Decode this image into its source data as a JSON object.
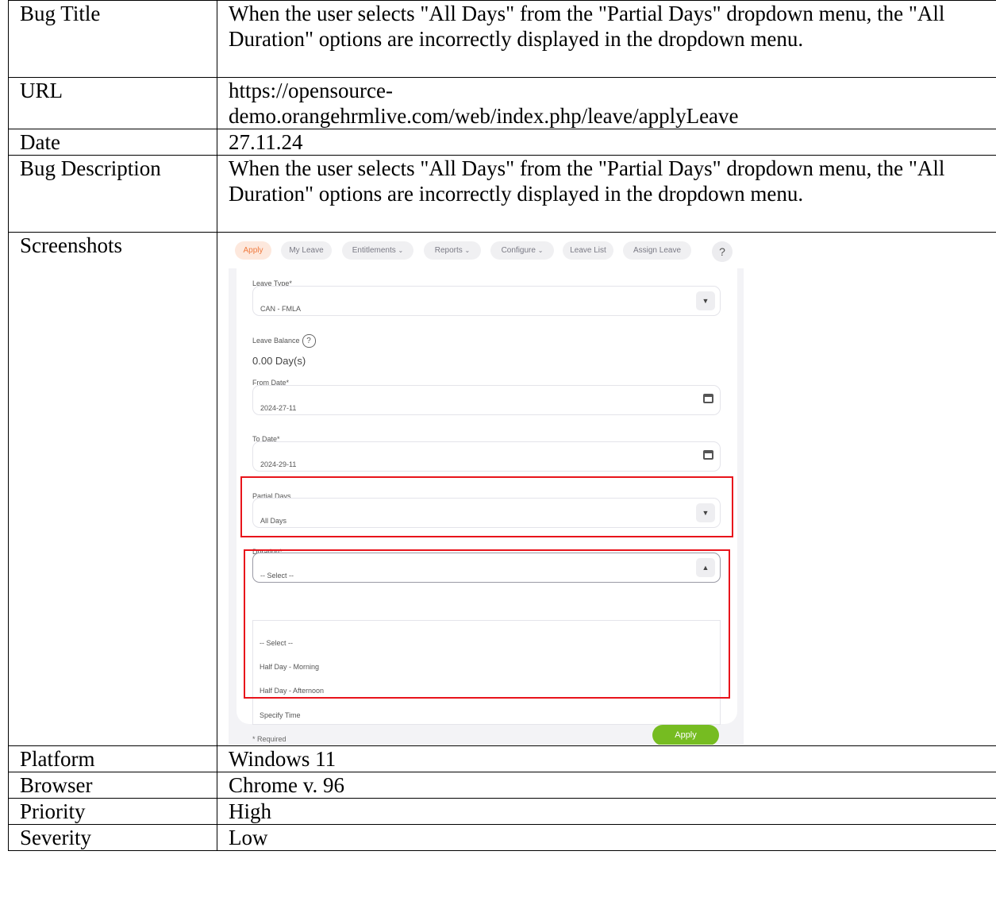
{
  "rows": {
    "bug_title": {
      "label": "Bug Title",
      "value": "When the user selects \"All Days\" from the \"Partial Days\" dropdown menu, the \"All Duration\" options are incorrectly displayed in the dropdown menu."
    },
    "url": {
      "label": "URL",
      "value": "https://opensource-demo.orangehrmlive.com/web/index.php/leave/applyLeave",
      "value_line1": "https://opensource-",
      "value_line2": "demo.orangehrmlive.com/web/index.php/leave/applyLeave"
    },
    "date": {
      "label": "Date",
      "value": "27.11.24"
    },
    "bug_description": {
      "label": "Bug Description",
      "value": "When the user selects \"All Days\" from the \"Partial Days\" dropdown menu, the \"All Duration\" options are incorrectly displayed in the dropdown menu."
    },
    "screenshots": {
      "label": "Screenshots"
    },
    "platform": {
      "label": "Platform",
      "value": "Windows 11"
    },
    "browser": {
      "label": "Browser",
      "value": "Chrome v. 96"
    },
    "priority": {
      "label": "Priority",
      "value": "High"
    },
    "severity": {
      "label": "Severity",
      "value": "Low"
    }
  },
  "screenshot": {
    "nav": {
      "apply": "Apply",
      "my_leave": "My Leave",
      "entitlements": "Entitlements",
      "reports": "Reports",
      "configure": "Configure",
      "leave_list": "Leave List",
      "assign_leave": "Assign Leave",
      "help": "?"
    },
    "form": {
      "leave_type_label": "Leave Type*",
      "leave_type_value": "CAN - FMLA",
      "leave_balance_label": "Leave Balance",
      "leave_balance_value": "0.00 Day(s)",
      "from_date_label": "From Date*",
      "from_date_value": "2024-27-11",
      "to_date_label": "To Date*",
      "to_date_value": "2024-29-11",
      "partial_days_label": "Partial Days",
      "partial_days_value": "All Days",
      "duration_label": "Duration*",
      "duration_value": "-- Select --",
      "duration_options": [
        "-- Select --",
        "Half Day - Morning",
        "Half Day - Afternoon",
        "Specify Time"
      ],
      "required_note": "* Required",
      "apply_button": "Apply"
    },
    "highlight_color": "#e8141b",
    "accent_color": "#ef7a3f",
    "apply_color": "#76bc21"
  }
}
